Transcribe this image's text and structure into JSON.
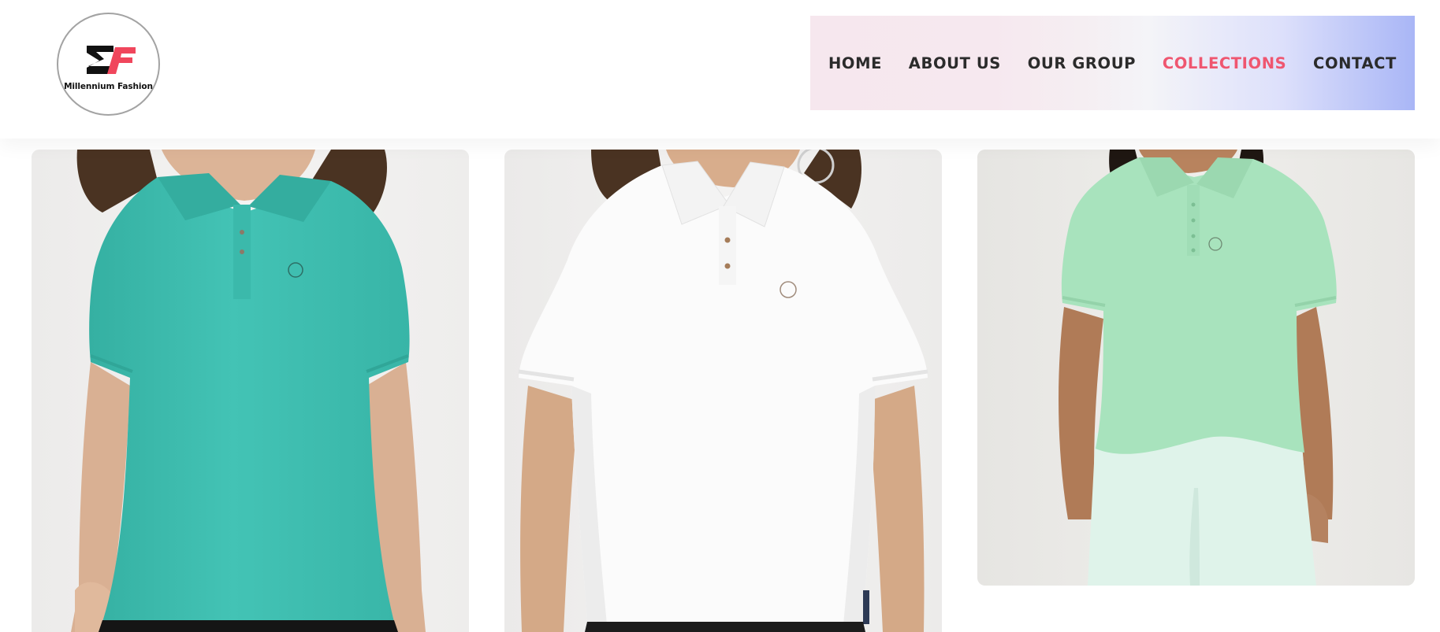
{
  "brand": {
    "logo_mark": "MF",
    "name": "Millennium Fashion",
    "colors": {
      "mark_dark": "#111111",
      "mark_accent": "#f0465c"
    }
  },
  "nav": {
    "items": [
      {
        "label": "HOME",
        "active": false
      },
      {
        "label": "ABOUT US",
        "active": false
      },
      {
        "label": "OUR GROUP",
        "active": false
      },
      {
        "label": "COLLECTIONS",
        "active": true
      },
      {
        "label": "CONTACT",
        "active": false
      }
    ],
    "colors": {
      "text": "#2b2b2b",
      "active": "#ef5670"
    }
  },
  "products": [
    {
      "name": "turquoise polo t-shirt",
      "color": "#3fbfb1"
    },
    {
      "name": "white polo t-shirt",
      "color": "#fafafa"
    },
    {
      "name": "mint polo t-shirt",
      "color": "#a6e3bc"
    }
  ]
}
